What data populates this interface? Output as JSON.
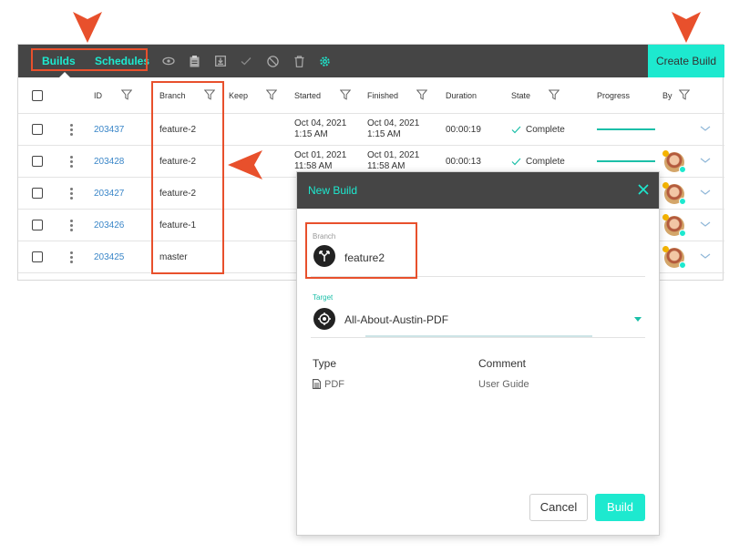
{
  "colors": {
    "accent": "#1de9cf",
    "toolbar_bg": "#454545",
    "annotation": "#e8502c",
    "link": "#3a86c8",
    "progress": "#1bbfa8"
  },
  "toolbar": {
    "tabs": [
      {
        "label": "Builds",
        "active": true
      },
      {
        "label": "Schedules",
        "active": false
      }
    ],
    "tools": [
      "eye-icon",
      "clipboard-icon",
      "download-icon",
      "check-icon",
      "cancel-icon",
      "trash-icon",
      "gear-icon"
    ],
    "create_label": "Create Build"
  },
  "table": {
    "headers": {
      "id": "ID",
      "branch": "Branch",
      "keep": "Keep",
      "started": "Started",
      "finished": "Finished",
      "duration": "Duration",
      "state": "State",
      "progress": "Progress",
      "by": "By"
    },
    "rows": [
      {
        "id": "203437",
        "branch": "feature-2",
        "started_date": "Oct 04, 2021",
        "started_time": "1:15 AM",
        "finished_date": "Oct 04, 2021",
        "finished_time": "1:15 AM",
        "duration": "00:00:19",
        "state": "Complete",
        "progress": 1.0
      },
      {
        "id": "203428",
        "branch": "feature-2",
        "started_date": "Oct 01, 2021",
        "started_time": "11:58 AM",
        "finished_date": "Oct 01, 2021",
        "finished_time": "11:58 AM",
        "duration": "00:00:13",
        "state": "Complete",
        "progress": 1.0
      },
      {
        "id": "203427",
        "branch": "feature-2"
      },
      {
        "id": "203426",
        "branch": "feature-1"
      },
      {
        "id": "203425",
        "branch": "master"
      }
    ]
  },
  "dialog": {
    "title": "New Build",
    "branch_label": "Branch",
    "branch_value": "feature2",
    "target_label": "Target",
    "target_value": "All-About-Austin-PDF",
    "type_label": "Type",
    "type_value": "PDF",
    "comment_label": "Comment",
    "comment_value": "User Guide",
    "cancel_label": "Cancel",
    "build_label": "Build"
  }
}
